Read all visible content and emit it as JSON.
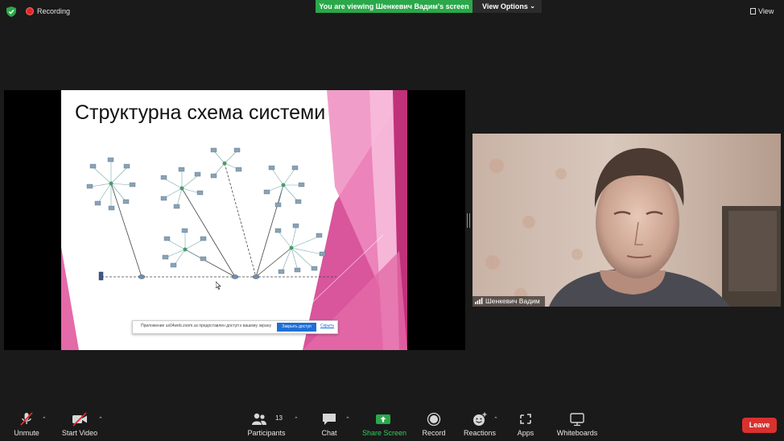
{
  "top_bar": {
    "recording_label": "Recording",
    "viewing_banner": "You are viewing Шенкевич Вадим's screen",
    "view_options_label": "View Options",
    "view_label": "View"
  },
  "shared_screen": {
    "slide_title": "Структурна схема системи",
    "notification": {
      "text": "Приложение us04web.zoom.us предоставлен доступ к вашему экрану",
      "stop_button": "Закрыть доступ",
      "hide_link": "Скрыть"
    }
  },
  "participant_video": {
    "name": "Шенкевич Вадим"
  },
  "toolbar": {
    "unmute": "Unmute",
    "start_video": "Start Video",
    "participants": "Participants",
    "participants_count": "13",
    "chat": "Chat",
    "share_screen": "Share Screen",
    "record": "Record",
    "reactions": "Reactions",
    "apps": "Apps",
    "whiteboards": "Whiteboards",
    "leave": "Leave"
  },
  "colors": {
    "share_green": "#2aa84a",
    "leave_red": "#d9312e",
    "recording_red": "#e02828",
    "slide_pink": "#e0529b"
  }
}
